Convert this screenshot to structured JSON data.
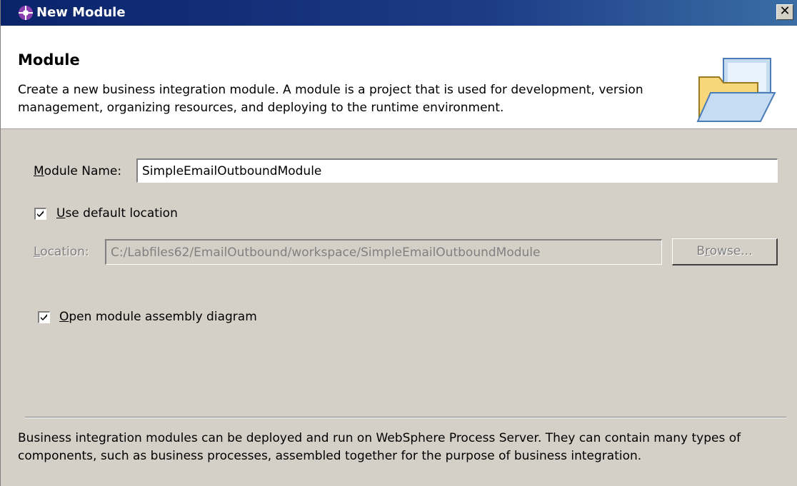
{
  "window": {
    "title": "New Module",
    "close_glyph": "✕",
    "app_icon": "wid-module-icon"
  },
  "banner": {
    "title": "Module",
    "description": "Create a new business integration module. A module is a project that is used for development, version management, organizing resources, and deploying to the runtime environment.",
    "icon": "open-folder-icon"
  },
  "form": {
    "module_name": {
      "label_underlined": "M",
      "label_rest": "odule Name:",
      "value": "SimpleEmailOutboundModule"
    },
    "use_default_location": {
      "label_underlined": "U",
      "label_rest": "se default location",
      "checked": true
    },
    "location": {
      "label_underlined": "L",
      "label_rest": "ocation:",
      "value": "C:/Labfiles62/EmailOutbound/workspace/SimpleEmailOutboundModule",
      "enabled": false
    },
    "browse_button": {
      "label_pre": "B",
      "label_underlined": "r",
      "label_post": "owse...",
      "enabled": false
    },
    "open_assembly_diagram": {
      "label_underlined": "O",
      "label_rest": "pen module assembly diagram",
      "checked": true
    }
  },
  "footer": {
    "text": "Business integration modules can be deployed and run on WebSphere Process Server. They can contain many types of components, such as business processes, assembled together for the purpose of business integration."
  },
  "colors": {
    "titlebar": "#0a246a",
    "dialog_bg": "#d4d0c8",
    "disabled_text": "#808080"
  }
}
